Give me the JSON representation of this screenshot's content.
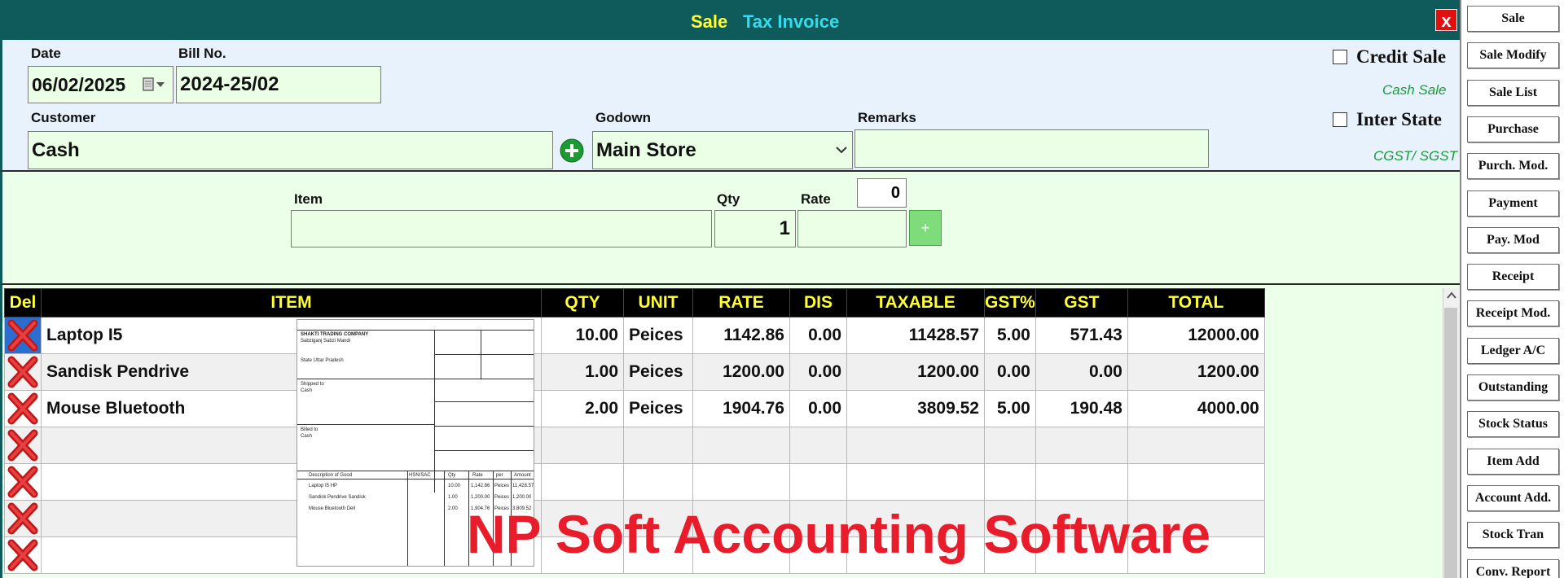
{
  "title": {
    "sale": "Sale",
    "tax_invoice": "Tax Invoice",
    "close": "x"
  },
  "header": {
    "date_label": "Date",
    "date_value": "06/02/2025",
    "bill_label": "Bill No.",
    "bill_value": "2024-25/02",
    "customer_label": "Customer",
    "customer_value": "Cash",
    "godown_label": "Godown",
    "godown_value": "Main Store",
    "remarks_label": "Remarks",
    "remarks_value": "",
    "credit_sale_label": "Credit Sale",
    "credit_sale_checked": false,
    "cash_sale_text": "Cash Sale",
    "inter_state_label": "Inter State",
    "inter_state_checked": false,
    "cgst_sgst_text": "CGST/ SGST"
  },
  "entry": {
    "item_label": "Item",
    "item_value": "",
    "qty_label": "Qty",
    "qty_value": "1",
    "rate_label": "Rate",
    "rate_value": "",
    "rate_extra_value": "0",
    "add_button": "+"
  },
  "grid": {
    "columns": [
      "Del",
      "ITEM",
      "QTY",
      "UNIT",
      "RATE",
      "DIS",
      "TAXABLE",
      "GST%",
      "GST",
      "TOTAL"
    ],
    "rows": [
      {
        "item": "Laptop I5",
        "qty": "10.00",
        "unit": "Peices",
        "rate": "1142.86",
        "dis": "0.00",
        "taxable": "11428.57",
        "gstp": "5.00",
        "gst": "571.43",
        "total": "12000.00"
      },
      {
        "item": "Sandisk Pendrive",
        "qty": "1.00",
        "unit": "Peices",
        "rate": "1200.00",
        "dis": "0.00",
        "taxable": "1200.00",
        "gstp": "0.00",
        "gst": "0.00",
        "total": "1200.00"
      },
      {
        "item": "Mouse Bluetooth",
        "qty": "2.00",
        "unit": "Peices",
        "rate": "1904.76",
        "dis": "0.00",
        "taxable": "3809.52",
        "gstp": "5.00",
        "gst": "190.48",
        "total": "4000.00"
      },
      {
        "item": "",
        "qty": "",
        "unit": "",
        "rate": "",
        "dis": "",
        "taxable": "",
        "gstp": "",
        "gst": "",
        "total": ""
      },
      {
        "item": "",
        "qty": "",
        "unit": "",
        "rate": "",
        "dis": "",
        "taxable": "",
        "gstp": "",
        "gst": "",
        "total": ""
      },
      {
        "item": "",
        "qty": "",
        "unit": "",
        "rate": "",
        "dis": "",
        "taxable": "",
        "gstp": "",
        "gst": "",
        "total": ""
      },
      {
        "item": "",
        "qty": "",
        "unit": "",
        "rate": "",
        "dis": "",
        "taxable": "",
        "gstp": "",
        "gst": "",
        "total": ""
      }
    ]
  },
  "side_menu": [
    "Sale",
    "Sale Modify",
    "Sale List",
    "Purchase",
    "Purch. Mod.",
    "Payment",
    "Pay. Mod",
    "Receipt",
    "Receipt Mod.",
    "Ledger A/C",
    "Outstanding",
    "Stock Status",
    "Item Add",
    "Account Add.",
    "Stock Tran",
    "Conv. Report"
  ],
  "invoice_preview": {
    "company": "SHAKTI TRADING COMPANY",
    "address": "Sabziganj Sabzi Mandi",
    "state_line": "State Uttar Pradesh",
    "shipped_to": "Shipped to",
    "billed_to": "Billed to",
    "cash": "Cash",
    "table_head": [
      "Description of Good",
      "HSN/SAC",
      "Qty",
      "Rate",
      "per",
      "Amount"
    ],
    "lines": [
      [
        "Laptop I5 HP",
        "10.00",
        "1,142.86",
        "Peices",
        "11,428.57"
      ],
      [
        "Sandisk Pendrive Sandisk",
        "1.00",
        "1,200.00",
        "Peices",
        "1,200.00"
      ],
      [
        "Mouse Bluetooth Dell",
        "2.00",
        "1,904.76",
        "Peices",
        "3,809.52"
      ]
    ]
  },
  "watermark": "NP Soft Accounting Software",
  "colors": {
    "titlebar": "#0f5a5a",
    "header_bg": "#e8f2fd",
    "entry_bg": "#ebffe9",
    "field_bg": "#eaffe6",
    "accent_red": "#e81c2a"
  }
}
